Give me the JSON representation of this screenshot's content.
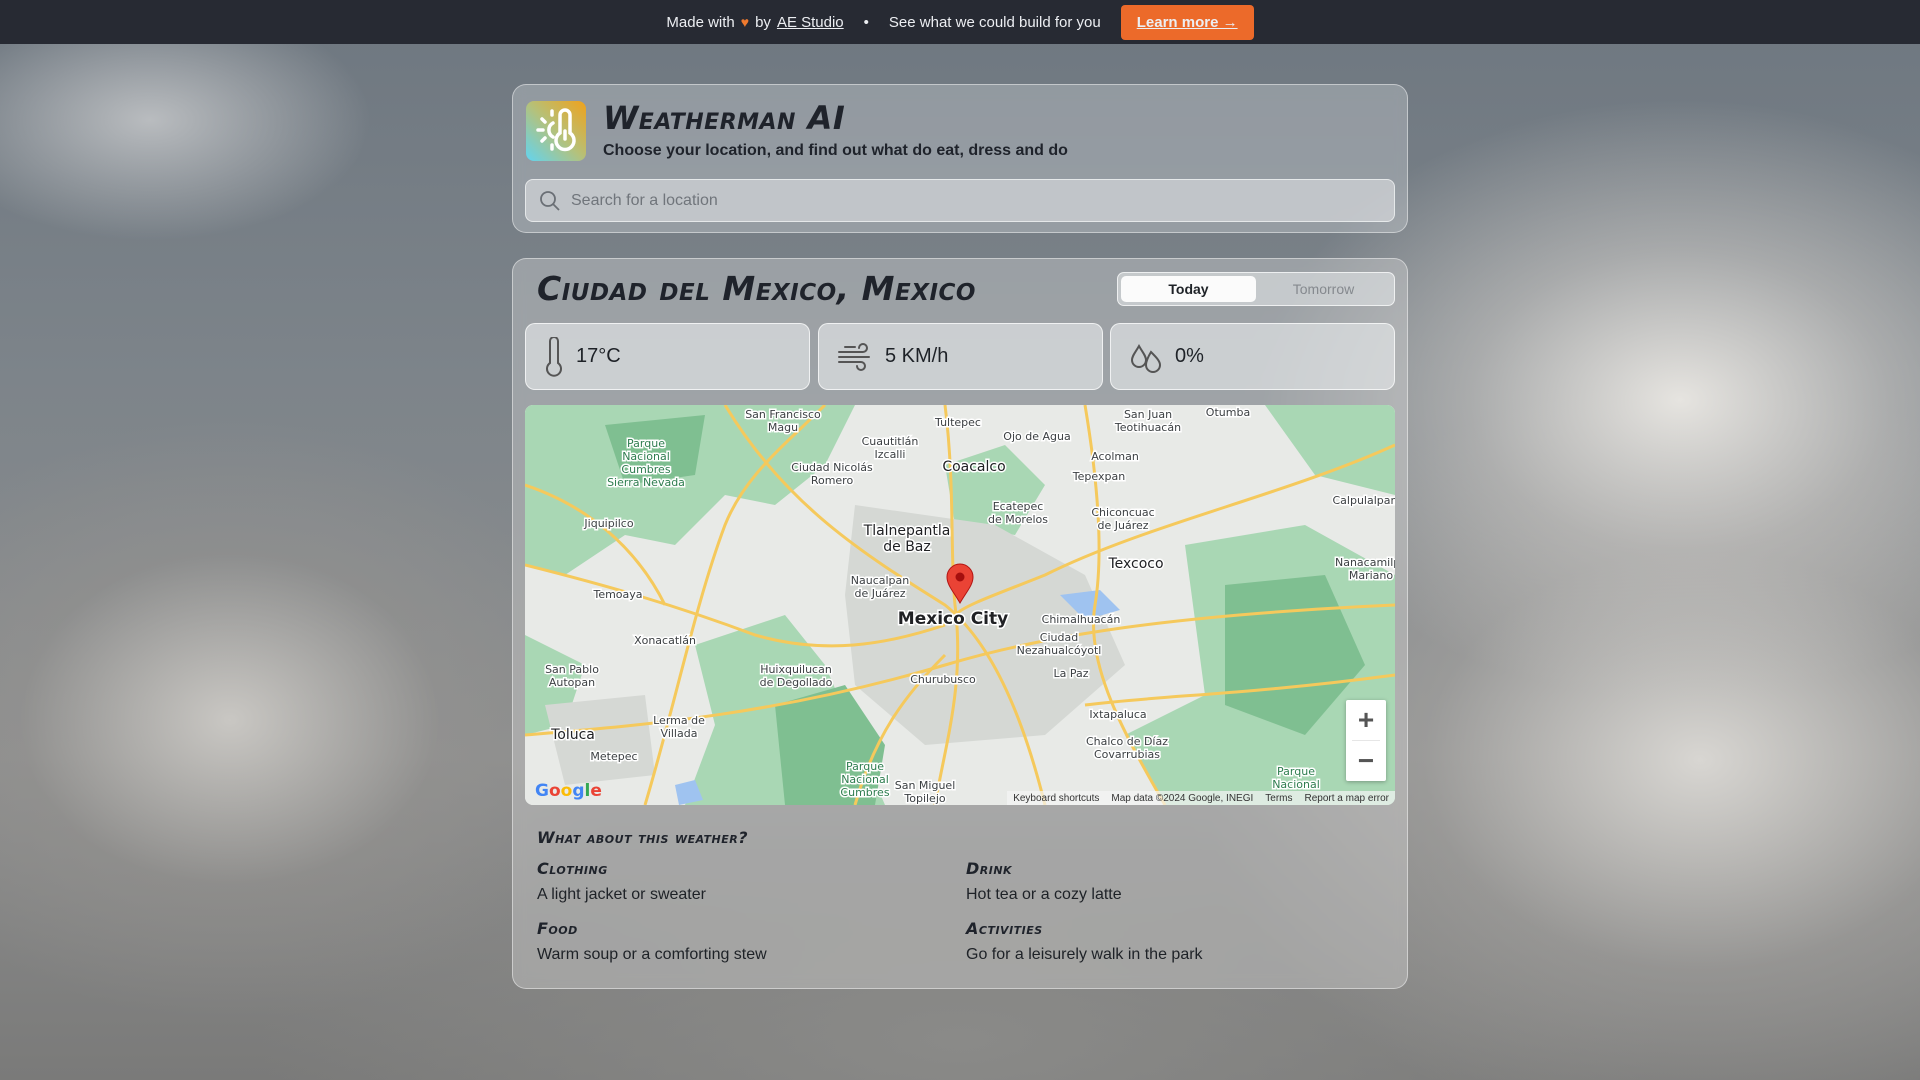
{
  "banner": {
    "made_with": "Made with",
    "by": "by",
    "studio": "AE Studio",
    "separator": "•",
    "pitch": "See what we could build for you",
    "cta": "Learn more →"
  },
  "app": {
    "title": "Weatherman AI",
    "subtitle": "Choose your location, and find out what do eat, dress and do",
    "search_placeholder": "Search for a location"
  },
  "location": {
    "name": "Ciudad del Mexico, Mexico",
    "tabs": [
      {
        "label": "Today",
        "active": true
      },
      {
        "label": "Tomorrow",
        "active": false
      }
    ]
  },
  "stats": {
    "temperature": "17°C",
    "wind": "5 KM/h",
    "precipitation": "0%"
  },
  "map": {
    "labels": [
      "Mexico City",
      "Tlalnepantla",
      "de Baz",
      "Coacalco",
      "Texcoco",
      "Toluca",
      "Naucalpan",
      "de Juárez",
      "Chimalhuacán",
      "Ciudad",
      "Nezahualcóyotl",
      "Churubusco",
      "La Paz",
      "Ixtapaluca",
      "Chalco de Díaz",
      "Covarrubias",
      "Huixquilucan",
      "de Degollado",
      "Lerma de",
      "Villada",
      "Metepec",
      "San Pablo",
      "Autopan",
      "Xonacatlán",
      "Temoaya",
      "Jiquipilco",
      "Parque",
      "Nacional",
      "Cumbres",
      "Sierra Nevada",
      "Ciudad Nicolás",
      "Romero",
      "Cuautitlán",
      "Izcalli",
      "San Francisco",
      "Magu",
      "Tultepec",
      "Ojo de Agua",
      "San Juan",
      "Teotihuacán",
      "Otumba",
      "Acolman",
      "Tepexpan",
      "Ecatepec",
      "de Morelos",
      "Chiconcuac",
      "de Juárez",
      "Calpulalpan",
      "Nanacamilpa",
      "Mariano",
      "Parque",
      "Nacional",
      "Cumbres",
      "San Miguel",
      "Topilejo",
      "Parque",
      "Nacional"
    ],
    "attribution": [
      "Keyboard shortcuts",
      "Map data ©2024 Google, INEGI",
      "Terms",
      "Report a map error"
    ],
    "google": [
      "G",
      "o",
      "o",
      "g",
      "l",
      "e"
    ],
    "zoom_in": "+",
    "zoom_out": "−"
  },
  "advice": {
    "heading": "What about this weather?",
    "items": [
      {
        "label": "Clothing",
        "text": "A light jacket or sweater"
      },
      {
        "label": "Drink",
        "text": "Hot tea or a cozy latte"
      },
      {
        "label": "Food",
        "text": "Warm soup or a comforting stew"
      },
      {
        "label": "Activities",
        "text": "Go for a leisurely walk in the park"
      }
    ]
  },
  "colors": {
    "accent": "#ec6a2a",
    "banner_bg": "#272a33",
    "map_pin": "#ea4335"
  }
}
